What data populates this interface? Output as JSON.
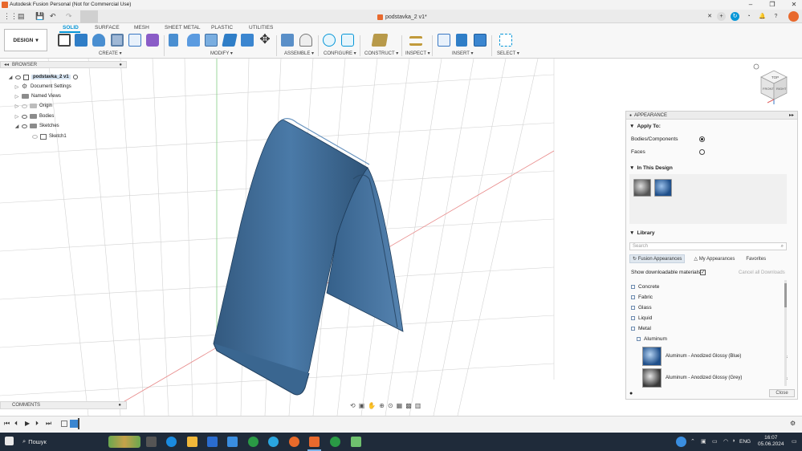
{
  "window": {
    "title": "Autodesk Fusion Personal (Not for Commercial Use)",
    "doc_tab": "podstavka_2 v1*"
  },
  "ribbon": {
    "design_label": "DESIGN",
    "workspace_tabs": [
      "SOLID",
      "SURFACE",
      "MESH",
      "SHEET METAL",
      "PLASTIC",
      "UTILITIES"
    ],
    "active_tab": "SOLID",
    "groups": {
      "create": "CREATE",
      "modify": "MODIFY",
      "assemble": "ASSEMBLE",
      "configure": "CONFIGURE",
      "construct": "CONSTRUCT",
      "inspect": "INSPECT",
      "insert": "INSERT",
      "select": "SELECT"
    }
  },
  "browser": {
    "header": "BROWSER",
    "root": "podstavka_2 v1",
    "items": [
      {
        "label": "Document Settings"
      },
      {
        "label": "Named Views"
      },
      {
        "label": "Origin"
      },
      {
        "label": "Bodies"
      },
      {
        "label": "Sketches"
      },
      {
        "label": "Sketch1"
      }
    ]
  },
  "comments": {
    "label": "COMMENTS"
  },
  "viewcube": {
    "top": "TOP",
    "front": "FRONT",
    "right": "RIGHT"
  },
  "appearance": {
    "header": "APPEARANCE",
    "apply_to": "Apply To:",
    "option_bodies": "Bodies/Components",
    "option_faces": "Faces",
    "selected_option": "Bodies/Components",
    "in_this_design": "In This Design",
    "library": "Library",
    "search_placeholder": "Search",
    "tabs": [
      "Fusion Appearances",
      "My Appearances",
      "Favorites"
    ],
    "show_downloadable": "Show downloadable materials",
    "show_downloadable_checked": true,
    "cancel_downloads": "Cancel all Downloads",
    "categories": [
      "Concrete",
      "Fabric",
      "Glass",
      "Liquid",
      "Metal"
    ],
    "subcategory": "Aluminum",
    "materials": [
      {
        "name": "Aluminum - Anodized Glossy (Blue)",
        "color": "#1f4f8a"
      },
      {
        "name": "Aluminum - Anodized Glossy (Grey)",
        "color": "#4a4a4a"
      }
    ],
    "close": "Close"
  },
  "taskbar": {
    "search_label": "Пошук",
    "lang": "ENG",
    "time": "16:07",
    "date": "05.06.2024"
  },
  "colors": {
    "accent": "#0696d7",
    "model": "#3f6a94",
    "grid": "#c9c9c9",
    "axis_red": "#e88a8a",
    "axis_green": "#8ad48a",
    "taskbar": "#1f2b3a"
  }
}
